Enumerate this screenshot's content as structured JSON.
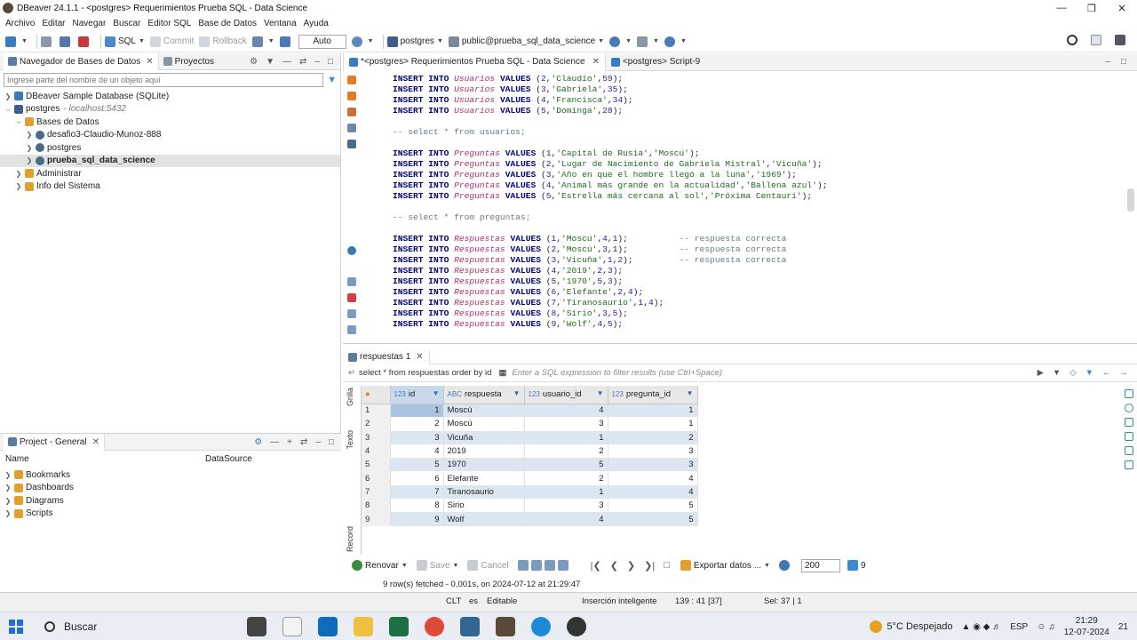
{
  "window": {
    "title": "DBeaver 24.1.1 - <postgres> Requerimientos Prueba SQL - Data Science"
  },
  "menu": [
    "Archivo",
    "Editar",
    "Navegar",
    "Buscar",
    "Editor SQL",
    "Base de Datos",
    "Ventana",
    "Ayuda"
  ],
  "toolbar": {
    "sql": "SQL",
    "commit": "Commit",
    "rollback": "Rollback",
    "mode": "Auto",
    "connection": "postgres",
    "schema": "public@prueba_sql_data_science"
  },
  "navigator": {
    "tab": "Navegador de Bases de Datos",
    "tab2": "Proyectos",
    "filter_placeholder": "Ingrese parte del nombre de un objeto aquí",
    "nodes": [
      {
        "label": "DBeaver Sample Database (SQLite)"
      },
      {
        "label": "postgres",
        "host": "- localhost:5432"
      },
      {
        "label": "Bases de Datos"
      },
      {
        "label": "desafio3-Claudio-Munoz-888"
      },
      {
        "label": "postgres"
      },
      {
        "label": "prueba_sql_data_science"
      },
      {
        "label": "Administrar"
      },
      {
        "label": "Info del Sistema"
      }
    ]
  },
  "project": {
    "tab": "Project - General",
    "col_name": "Name",
    "col_source": "DataSource",
    "items": [
      "Bookmarks",
      "Dashboards",
      "Diagrams",
      "Scripts"
    ]
  },
  "editor": {
    "tab_active": "*<postgres> Requerimientos Prueba SQL - Data Science",
    "tab2": "<postgres> Script-9"
  },
  "results": {
    "tab": "respuestas 1",
    "query": "select * from respuestas order by id",
    "filter_placeholder": "Enter a SQL expression to filter results (use Ctrl+Space)",
    "vtab_grid": "Grilla",
    "vtab_text": "Texto",
    "vtab_record": "Record",
    "columns": [
      "id",
      "respuesta",
      "usuario_id",
      "pregunta_id"
    ],
    "col_types": [
      "123",
      "ABC",
      "123",
      "123"
    ],
    "rows": [
      [
        "1",
        "1",
        "Moscú",
        "4",
        "1"
      ],
      [
        "2",
        "2",
        "Moscú",
        "3",
        "1"
      ],
      [
        "3",
        "3",
        "Vicuña",
        "1",
        "2"
      ],
      [
        "4",
        "4",
        "2019",
        "2",
        "3"
      ],
      [
        "5",
        "5",
        "1970",
        "5",
        "3"
      ],
      [
        "6",
        "6",
        "Elefante",
        "2",
        "4"
      ],
      [
        "7",
        "7",
        "Tiranosaurio",
        "1",
        "4"
      ],
      [
        "8",
        "8",
        "Sirio",
        "3",
        "5"
      ],
      [
        "9",
        "9",
        "Wolf",
        "4",
        "5"
      ]
    ],
    "refresh": "Renovar",
    "save": "Save",
    "cancel": "Cancel",
    "export": "Exportar datos ...",
    "fetch_size": "200",
    "row_count": "9",
    "fetched": "9 row(s) fetched - 0,001s, on 2024-07-12 at 21:29:47"
  },
  "status": {
    "tz": "CLT",
    "lang": "es",
    "mode": "Editable",
    "insert": "Inserción inteligente",
    "pos": "139 : 41 [37]",
    "sel": "Sel: 37 | 1"
  },
  "taskbar": {
    "search": "Buscar",
    "weather": "5°C  Despejado",
    "lang": "ESP",
    "time": "21:29",
    "date": "12-07-2024",
    "notif": "21"
  }
}
